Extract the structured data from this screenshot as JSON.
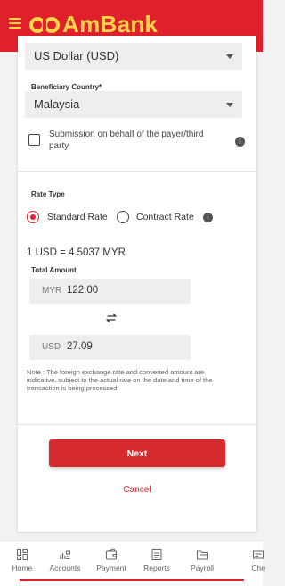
{
  "header": {
    "brand": "AmBank",
    "brand_color": "#ffd54a",
    "bar_color": "#e0202a"
  },
  "form": {
    "currency_select": {
      "value": "US Dollar (USD)"
    },
    "beneficiary_country": {
      "label": "Beneficiary Country*",
      "value": "Malaysia"
    },
    "on_behalf": {
      "label": "Submission on behalf of the payer/third party",
      "checked": false
    },
    "rate_type": {
      "label": "Rate Type",
      "options": [
        {
          "label": "Standard Rate",
          "selected": true
        },
        {
          "label": "Contract Rate",
          "selected": false
        }
      ]
    },
    "exchange_rate": "1 USD = 4.5037 MYR",
    "total_amount": {
      "label": "Total Amount",
      "from": {
        "currency": "MYR",
        "value": "122.00"
      },
      "to": {
        "currency": "USD",
        "value": "27.09"
      }
    },
    "note": "Note : The foreign exchange rate and converted amount are indicative, subject to the actual rate on the date and time of the transaction is being processed.",
    "next_label": "Next",
    "cancel_label": "Cancel"
  },
  "nav": {
    "items": [
      {
        "label": "Home",
        "icon": "home-icon"
      },
      {
        "label": "Accounts",
        "icon": "accounts-icon"
      },
      {
        "label": "Payment",
        "icon": "payment-icon"
      },
      {
        "label": "Reports",
        "icon": "reports-icon"
      },
      {
        "label": "Payroll",
        "icon": "payroll-icon"
      },
      {
        "label": "Che",
        "icon": "cheque-icon"
      }
    ]
  }
}
